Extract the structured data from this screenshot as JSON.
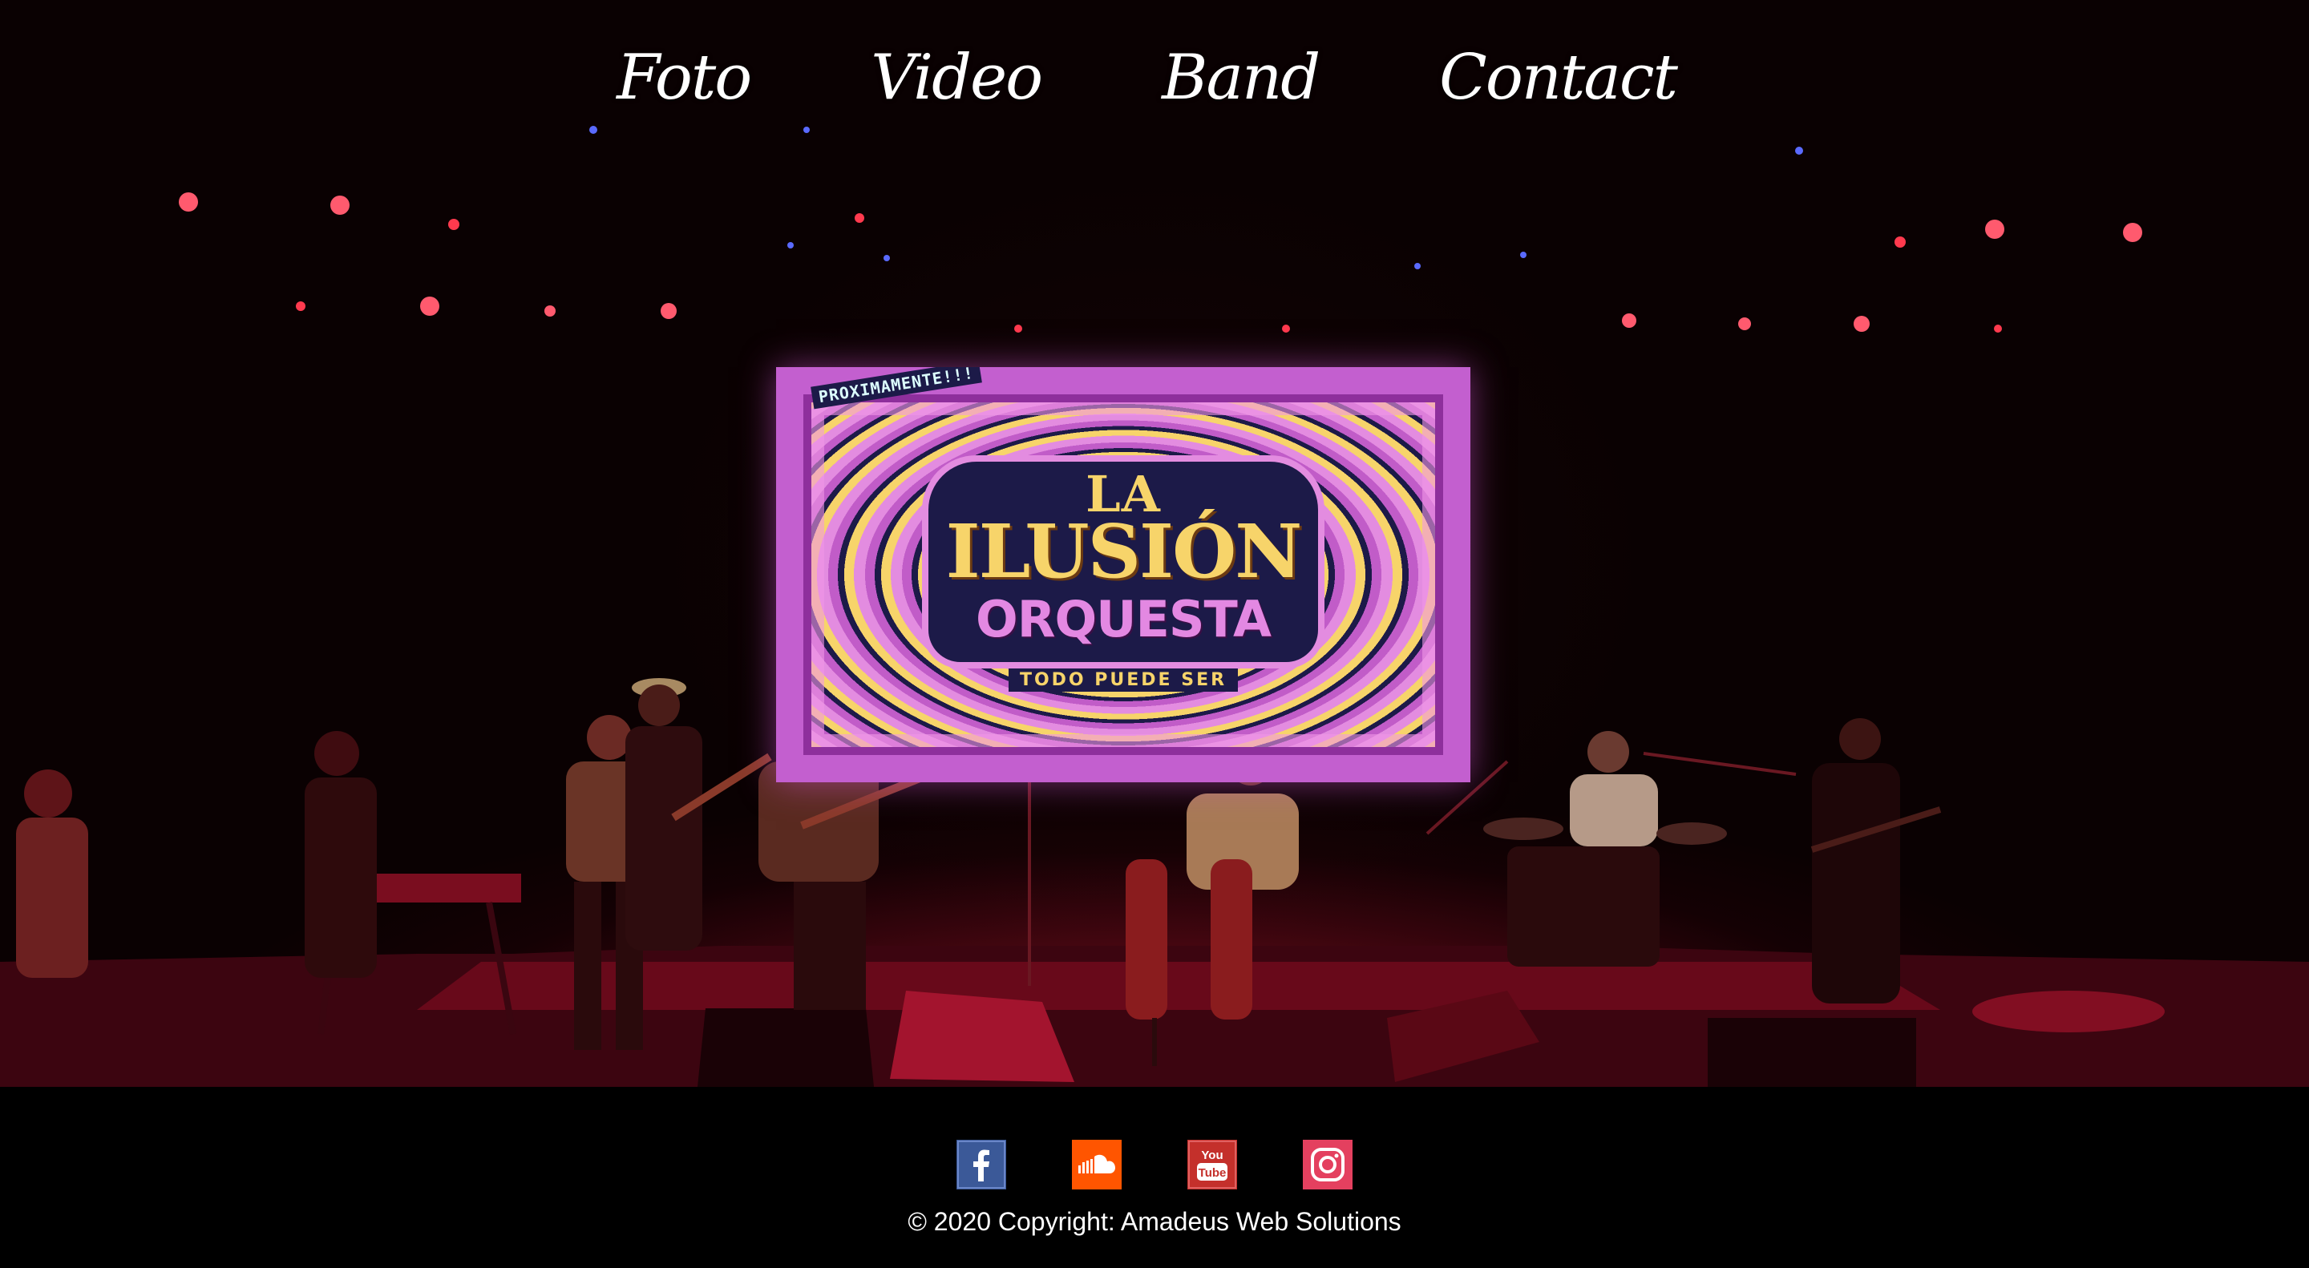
{
  "nav": {
    "items": [
      {
        "label": "Foto"
      },
      {
        "label": "Video"
      },
      {
        "label": "Band"
      },
      {
        "label": "Contact"
      }
    ]
  },
  "hero": {
    "screen": {
      "badge": "PROXIMAMENTE!!!",
      "line1": "LA",
      "line2": "ILUSIÓN",
      "line3": "ORQUESTA",
      "tagline": "TODO PUEDE SER"
    }
  },
  "footer": {
    "social": [
      {
        "name": "facebook-icon",
        "color": "#3b5998"
      },
      {
        "name": "soundcloud-icon",
        "color": "#ff5500"
      },
      {
        "name": "youtube-icon",
        "color": "#e52d27"
      },
      {
        "name": "instagram-icon",
        "color": "#e4405f"
      }
    ],
    "copyright": "© 2020 Copyright: Amadeus Web Solutions"
  },
  "colors": {
    "background": "#000000",
    "stage_red": "#c81432",
    "poster_magenta": "#c35fcf",
    "poster_yellow": "#f7d46a"
  }
}
